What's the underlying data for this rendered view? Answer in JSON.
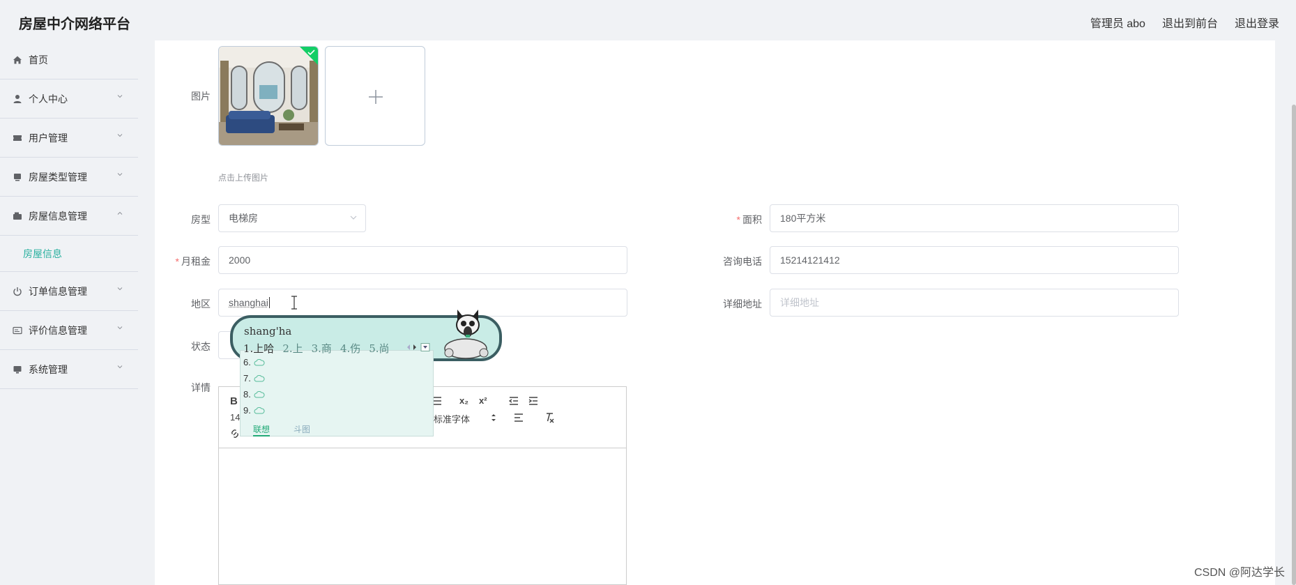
{
  "app": {
    "title": "房屋中介网络平台"
  },
  "header": {
    "user": "管理员 abo",
    "front": "退出到前台",
    "logout": "退出登录"
  },
  "sidebar": {
    "items": [
      {
        "label": "首页",
        "icon": "home-icon"
      },
      {
        "label": "个人中心",
        "icon": "user-icon"
      },
      {
        "label": "用户管理",
        "icon": "ticket-icon"
      },
      {
        "label": "房屋类型管理",
        "icon": "monitor-icon"
      },
      {
        "label": "房屋信息管理",
        "icon": "wallet-icon",
        "expanded": true
      },
      {
        "label": "订单信息管理",
        "icon": "power-icon"
      },
      {
        "label": "评价信息管理",
        "icon": "card-icon"
      },
      {
        "label": "系统管理",
        "icon": "computer-icon"
      }
    ],
    "sub_item": "房屋信息"
  },
  "form": {
    "image_label": "图片",
    "upload_hint": "点击上传图片",
    "house_type_label": "房型",
    "house_type_value": "电梯房",
    "area_label": "面积",
    "area_value": "180平方米",
    "rent_label": "月租金",
    "rent_value": "2000",
    "phone_label": "咨询电话",
    "phone_value": "15214121412",
    "region_label": "地区",
    "region_value": "shanghai",
    "address_label": "详细地址",
    "address_placeholder": "详细地址",
    "status_label": "状态",
    "detail_label": "详情",
    "required_mark": "*"
  },
  "editor": {
    "bold": "B",
    "font_size": "14",
    "font_family": "标准字体",
    "subscript": "x₂",
    "superscript": "x²"
  },
  "ime": {
    "composition": "shang'ha",
    "candidates": [
      "1.上哈",
      "2.上",
      "3.商",
      "4.伤",
      "5.尚"
    ],
    "extras": [
      "6.",
      "7.",
      "8.",
      "9."
    ],
    "tabs": [
      "联想",
      "斗图"
    ]
  },
  "watermark": "CSDN @阿达学长",
  "colors": {
    "accent": "#2bb1a0",
    "required": "#f56c6c",
    "ime_border": "#3b5e62"
  }
}
